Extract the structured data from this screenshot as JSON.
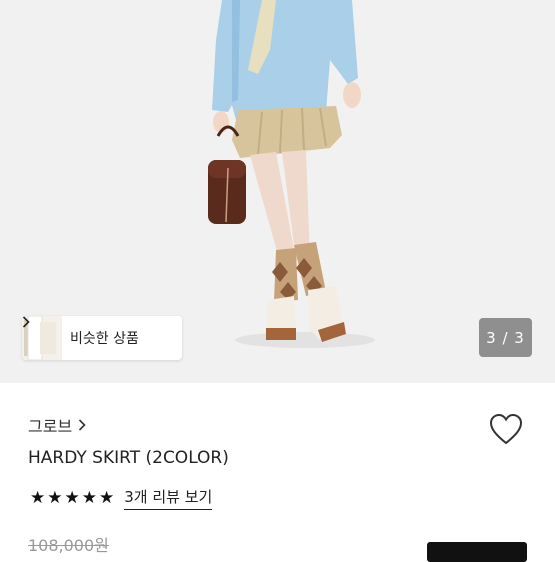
{
  "similar": {
    "label": "비슷한 상품"
  },
  "counter": {
    "text": "3 / 3"
  },
  "product": {
    "brand": "그로브",
    "title": "HARDY SKIRT (2COLOR)",
    "rating_stars": 5,
    "reviews_link": "3개 리뷰 보기",
    "original_price": "108,000원"
  },
  "icons": {
    "brand_chevron": "chevron-right-icon",
    "similar_chevron": "chevron-right-icon",
    "wishlist": "heart-outline-icon",
    "star": "star-icon"
  }
}
